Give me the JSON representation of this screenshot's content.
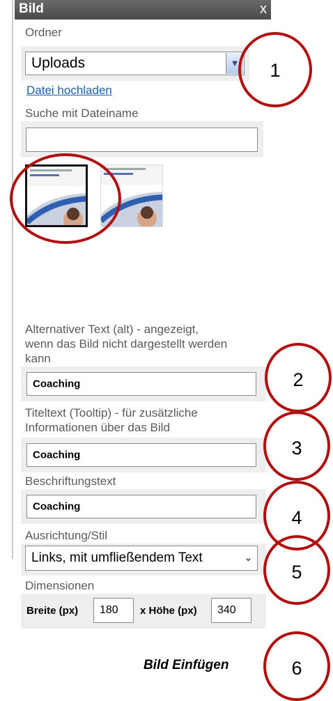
{
  "dialog": {
    "title": "Bild",
    "close": "x"
  },
  "folder": {
    "label": "Ordner",
    "value": "Uploads"
  },
  "upload_link": "Datei hochladen",
  "search": {
    "label": "Suche mit Dateiname",
    "value": ""
  },
  "alt_text": {
    "label_line1": "Alternativer Text (alt) - angezeigt,",
    "label_line2": "wenn das Bild nicht dargestellt werden",
    "label_line3": "kann",
    "value": "Coaching"
  },
  "title_text": {
    "label_line1": "Titeltext (Tooltip) - für zusätzliche",
    "label_line2": "Informationen über das Bild",
    "value": "Coaching"
  },
  "caption": {
    "label": "Beschriftungstext",
    "value": "Coaching"
  },
  "alignment": {
    "label": "Ausrichtung/Stil",
    "value": "Links, mit umfließendem Text"
  },
  "dimensions": {
    "label": "Dimensionen",
    "width_label": "Breite (px)",
    "width_value": "180",
    "height_label": "x Höhe (px)",
    "height_value": "340"
  },
  "insert_button": "Bild Einfügen",
  "annotations": [
    "1",
    "2",
    "3",
    "4",
    "5",
    "6"
  ],
  "colors": {
    "annotation": "#b01010",
    "link": "#1a5fa8",
    "titlebar": "#4a4a4a"
  }
}
